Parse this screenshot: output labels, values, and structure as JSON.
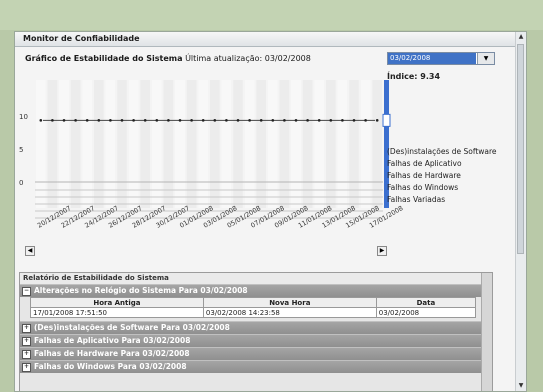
{
  "window": {
    "title": "Monitor de Confiabilidade"
  },
  "header": {
    "chart_title": "Gráfico de Estabilidade do Sistema",
    "last_update": "Última atualização: 03/02/2008"
  },
  "date_select": {
    "value": "03/02/2008"
  },
  "index": {
    "label": "Índice: 9.34"
  },
  "legend": {
    "items": [
      "(Des)instalações de Software",
      "Falhas de Aplicativo",
      "Falhas de Hardware",
      "Falhas do Windows",
      "Falhas Variadas"
    ]
  },
  "chart_data": {
    "type": "line",
    "title": "Gráfico de Estabilidade do Sistema",
    "xlabel": "",
    "ylabel": "",
    "ylim": [
      0,
      10
    ],
    "yticks": [
      "10",
      "5",
      "0"
    ],
    "x": [
      "20/12/2007",
      "22/12/2007",
      "24/12/2007",
      "26/12/2007",
      "28/12/2007",
      "30/12/2007",
      "01/01/2008",
      "03/01/2008",
      "05/01/2008",
      "07/01/2008",
      "09/01/2008",
      "11/01/2008",
      "13/01/2008",
      "15/01/2008",
      "17/01/2008"
    ],
    "series": [
      {
        "values": [
          9.34,
          9.34,
          9.34,
          9.34,
          9.34,
          9.34,
          9.34,
          9.34,
          9.34,
          9.34,
          9.34,
          9.34,
          9.34,
          9.34,
          9.34
        ]
      }
    ]
  },
  "report": {
    "title": "Relatório de Estabilidade do Sistema",
    "expanded_group": "Alterações no Relógio do Sistema Para 03/02/2008",
    "columns": [
      "Hora Antiga",
      "Nova Hora",
      "Data"
    ],
    "rows": [
      [
        "17/01/2008 17:51:50",
        "03/02/2008 14:23:58",
        "03/02/2008"
      ]
    ],
    "collapsed_groups": [
      "(Des)instalações de Software Para 03/02/2008",
      "Falhas de Aplicativo Para 03/02/2008",
      "Falhas de Hardware Para 03/02/2008",
      "Falhas do Windows Para 03/02/2008"
    ]
  }
}
